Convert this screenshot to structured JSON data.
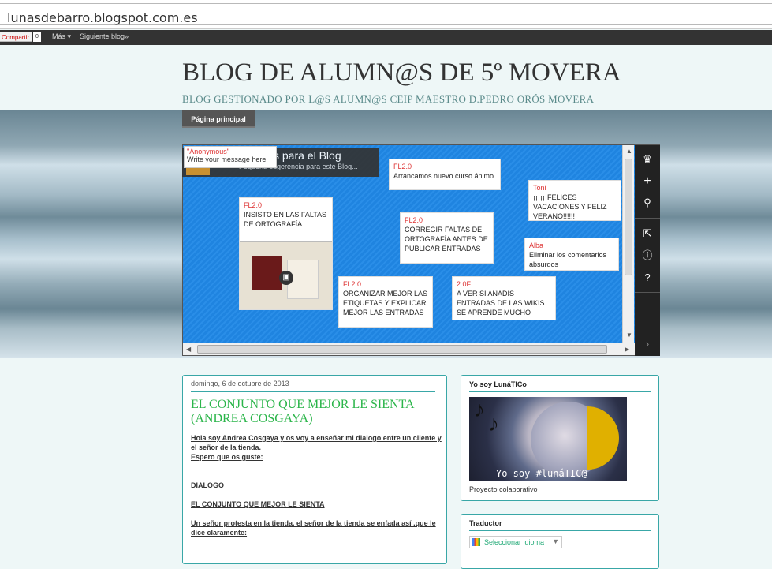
{
  "browser": {
    "url": "lunasdebarro.blogspot.com.es"
  },
  "navbar": {
    "share": "Compartir",
    "count": "0",
    "more": "Más ▾",
    "next": "Siguiente blog»"
  },
  "header": {
    "title": "BLOG DE ALUMN@S DE 5º MOVERA",
    "subtitle": "BLOG GESTIONADO POR L@S ALUMN@S CEIP MAESTRO D.PEDRO ORÓS MOVERA",
    "tab": "Página principal"
  },
  "padlet": {
    "title": "s para el Blog",
    "subtitle": "Pequeña sugerencia para este Blog...",
    "anon_name": "\"Anonymous\"",
    "anon_placeholder": "Write your message here",
    "notes": [
      {
        "author": "FL2.0",
        "text": "Arrancamos nuevo curso ánimo"
      },
      {
        "author": "Toni",
        "text": "¡¡¡¡¡¡FELICES VACACIONES Y FELIZ VERANO!!!!!!"
      },
      {
        "author": "FL2.0",
        "text": "INSISTO EN LAS FALTAS DE ORTOGRAFÍA"
      },
      {
        "author": "FL2.0",
        "text": "CORREGIR FALTAS DE ORTOGRAFÍA ANTES DE PUBLICAR ENTRADAS"
      },
      {
        "author": "Alba",
        "text": "Eliminar los comentarios absurdos"
      },
      {
        "author": "FL2.0",
        "text": "ORGANIZAR MEJOR LAS ETIQUETAS Y EXPLICAR MEJOR LAS ENTRADAS"
      },
      {
        "author": "2.0F",
        "text": "A VER SI AÑADÍS ENTRADAS DE LAS WIKIS. SE APRENDE MUCHO"
      }
    ],
    "toolbar_icons": [
      "origami-logo-icon",
      "plus-icon",
      "wrench-icon",
      "share-icon",
      "info-icon",
      "help-icon",
      "next-arrow-icon"
    ]
  },
  "post": {
    "date": "domingo, 6 de octubre de 2013",
    "title": "EL CONJUNTO QUE MEJOR LE SIENTA (ANDREA COSGAYA)",
    "p1": "Hola soy Andrea Cosgaya y os voy a enseñar mi dialogo entre un cliente y el señor de la tienda.",
    "p2": "Espero que os guste:",
    "p3": "DIALOGO",
    "p4": "EL CONJUNTO QUE MEJOR LE SIENTA",
    "p5": "Un señor protesta en la tienda, el señor de la tienda se enfada  así ,que  le dice claramente:"
  },
  "sidebar": {
    "yosoy_title": "Yo soy LunáTICo",
    "yosoy_image_caption": "Yo soy  #lunáTIC@",
    "yosoy_caption": "Proyecto colaborativo",
    "translator_title": "Traductor",
    "translator_select": "Seleccionar idioma"
  }
}
